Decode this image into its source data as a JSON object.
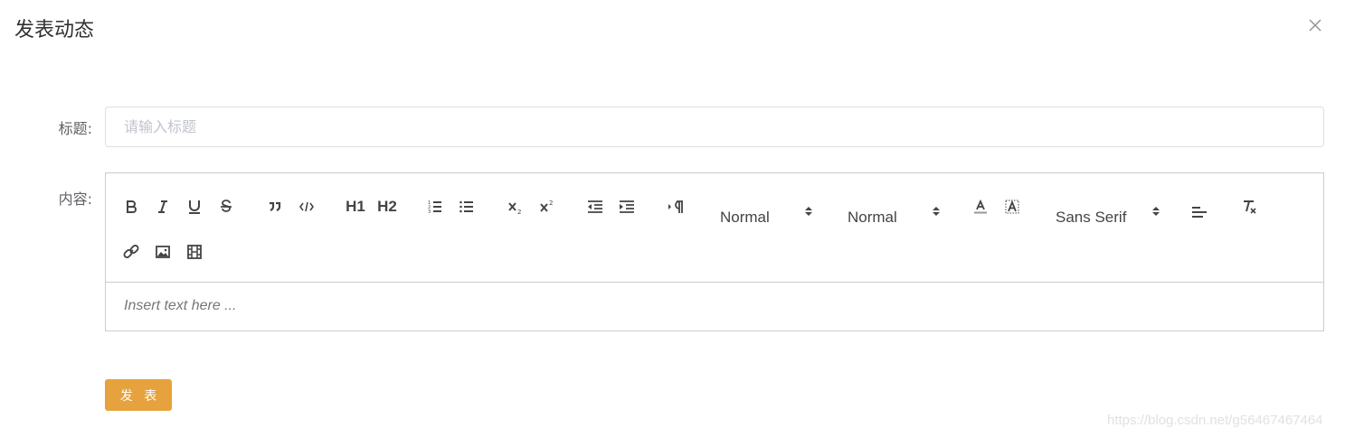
{
  "dialog": {
    "title": "发表动态",
    "close_icon": "close-icon"
  },
  "form": {
    "title_label": "标题:",
    "title_placeholder": "请输入标题",
    "title_value": "",
    "content_label": "内容:"
  },
  "editor": {
    "toolbar": {
      "bold_icon": "bold-icon",
      "italic_icon": "italic-icon",
      "underline_icon": "underline-icon",
      "strike_icon": "strikethrough-icon",
      "blockquote_icon": "quote-icon",
      "code_block_icon": "code-icon",
      "h1": "H1",
      "h2": "H2",
      "ordered_list_icon": "ordered-list-icon",
      "bullet_list_icon": "bullet-list-icon",
      "subscript_icon": "subscript-icon",
      "superscript_icon": "superscript-icon",
      "outdent_icon": "outdent-icon",
      "indent_icon": "indent-icon",
      "direction_icon": "text-direction-icon",
      "size_picker": "Normal",
      "header_picker": "Normal",
      "color_icon": "text-color-icon",
      "background_icon": "background-color-icon",
      "font_picker": "Sans Serif",
      "align_icon": "align-left-icon",
      "clean_icon": "clear-format-icon",
      "link_icon": "link-icon",
      "image_icon": "image-icon",
      "video_icon": "video-icon"
    },
    "placeholder": "Insert text here ..."
  },
  "actions": {
    "submit_label": "发 表"
  },
  "watermark": "https://blog.csdn.net/g56467467464"
}
